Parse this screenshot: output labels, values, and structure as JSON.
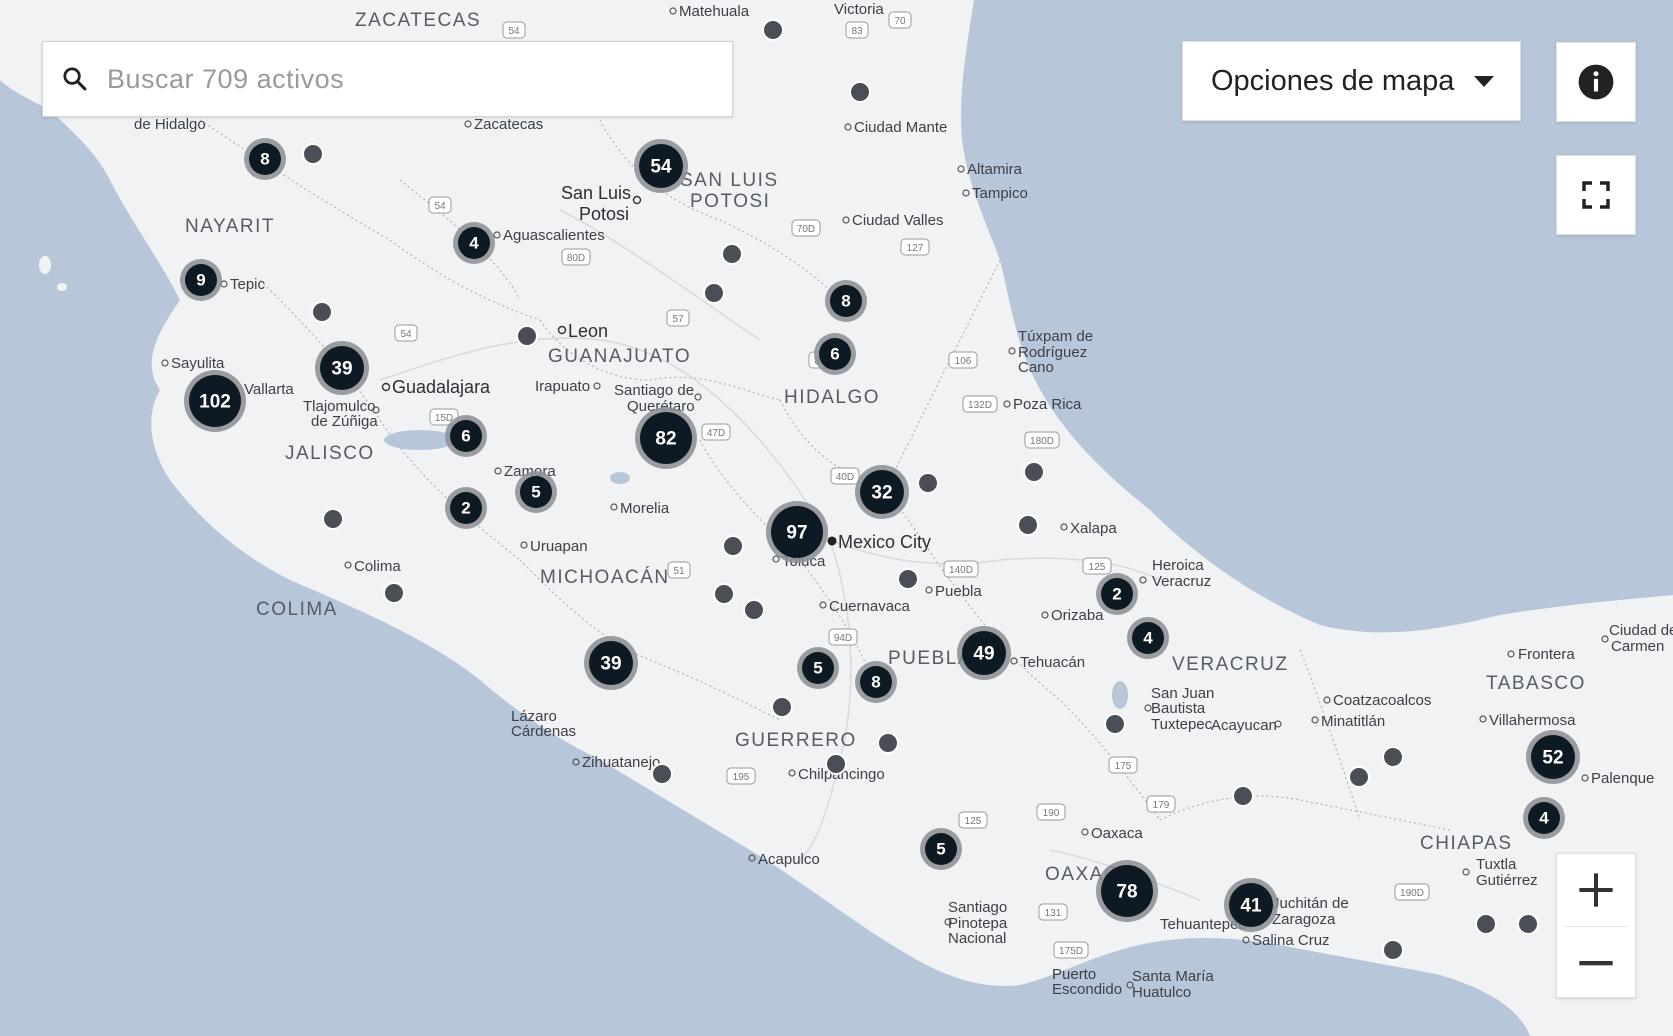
{
  "search": {
    "placeholder": "Buscar 709 activos"
  },
  "map_options": {
    "label": "Opciones de mapa"
  },
  "controls": {
    "info_icon": "info-icon",
    "fullscreen_icon": "fullscreen-icon",
    "zoom_in_icon": "plus-icon",
    "zoom_out_icon": "minus-icon"
  },
  "colors": {
    "water": "#b8c6da",
    "land": "#f1f2f3",
    "cluster": "#0e1a23",
    "marker": "#4a4f57"
  },
  "states": [
    {
      "name": "ZACATECAS"
    },
    {
      "name": "NAYARIT"
    },
    {
      "name": "SAN LUIS"
    },
    {
      "name": "POTOSI"
    },
    {
      "name": "GUANAJUATO"
    },
    {
      "name": "HIDALGO"
    },
    {
      "name": "JALISCO"
    },
    {
      "name": "MICHOACÁN"
    },
    {
      "name": "COLIMA"
    },
    {
      "name": "PUEBLA"
    },
    {
      "name": "VERACRUZ"
    },
    {
      "name": "GUERRERO"
    },
    {
      "name": "OAXACA"
    },
    {
      "name": "TABASCO"
    },
    {
      "name": "CHIAPAS"
    }
  ],
  "cities": [
    {
      "name": "Matehuala"
    },
    {
      "name": "Victoria"
    },
    {
      "name": "de Hidalgo"
    },
    {
      "name": "Zacatecas"
    },
    {
      "name": "Ciudad Mante"
    },
    {
      "name": "San Luis"
    },
    {
      "name": "Potosi"
    },
    {
      "name": "Altamira"
    },
    {
      "name": "Tampico"
    },
    {
      "name": "Aguascalientes"
    },
    {
      "name": "Ciudad Valles"
    },
    {
      "name": "Tepic"
    },
    {
      "name": "Leon"
    },
    {
      "name": "Túxpam de"
    },
    {
      "name": "Rodríguez"
    },
    {
      "name": "Cano"
    },
    {
      "name": "Sayulita"
    },
    {
      "name": "Vallarta"
    },
    {
      "name": "Guadalajara"
    },
    {
      "name": "Irapuato"
    },
    {
      "name": "Santiago de"
    },
    {
      "name": "Querétaro"
    },
    {
      "name": "Poza Rica"
    },
    {
      "name": "Tlajomulco"
    },
    {
      "name": "de Zúñiga"
    },
    {
      "name": "Zamora"
    },
    {
      "name": "Morelia"
    },
    {
      "name": "Mexico City"
    },
    {
      "name": "Xalapa"
    },
    {
      "name": "Uruapan"
    },
    {
      "name": "Toluca"
    },
    {
      "name": "Colima"
    },
    {
      "name": "Heroica"
    },
    {
      "name": "Veracruz"
    },
    {
      "name": "Puebla"
    },
    {
      "name": "Cuernavaca"
    },
    {
      "name": "Orizaba"
    },
    {
      "name": "Tehuacán"
    },
    {
      "name": "Frontera"
    },
    {
      "name": "Ciudad del"
    },
    {
      "name": "Carmen"
    },
    {
      "name": "San Juan"
    },
    {
      "name": "Bautista"
    },
    {
      "name": "Tuxtepec"
    },
    {
      "name": "Acayucan"
    },
    {
      "name": "Coatzacoalcos"
    },
    {
      "name": "Minatitlán"
    },
    {
      "name": "Villahermosa"
    },
    {
      "name": "Lázaro"
    },
    {
      "name": "Cárdenas"
    },
    {
      "name": "Zihuatanejo"
    },
    {
      "name": "Chilpancingo"
    },
    {
      "name": "Palenque"
    },
    {
      "name": "Oaxaca"
    },
    {
      "name": "Acapulco"
    },
    {
      "name": "Tuxtla"
    },
    {
      "name": "Gutiérrez"
    },
    {
      "name": "Santiago"
    },
    {
      "name": "Pinotepa"
    },
    {
      "name": "Nacional"
    },
    {
      "name": "Juchitán de"
    },
    {
      "name": "Zaragoza"
    },
    {
      "name": "Tehuantepec"
    },
    {
      "name": "Salina Cruz"
    },
    {
      "name": "Puerto"
    },
    {
      "name": "Escondido"
    },
    {
      "name": "Santa María"
    },
    {
      "name": "Huatulco"
    },
    {
      "name": "Ciudad Mante"
    }
  ],
  "highways": [
    "54",
    "83",
    "70",
    "54",
    "70D",
    "127",
    "80D",
    "57",
    "54",
    "106",
    "85",
    "132D",
    "15D",
    "180D",
    "47D",
    "40D",
    "51",
    "140D",
    "125",
    "94D",
    "195",
    "125",
    "190",
    "175",
    "179",
    "131",
    "175D",
    "190D"
  ],
  "clusters": [
    {
      "count": "8"
    },
    {
      "count": "54"
    },
    {
      "count": "4"
    },
    {
      "count": "9"
    },
    {
      "count": "8"
    },
    {
      "count": "6"
    },
    {
      "count": "39"
    },
    {
      "count": "102"
    },
    {
      "count": "82"
    },
    {
      "count": "6"
    },
    {
      "count": "5"
    },
    {
      "count": "2"
    },
    {
      "count": "32"
    },
    {
      "count": "97"
    },
    {
      "count": "2"
    },
    {
      "count": "4"
    },
    {
      "count": "49"
    },
    {
      "count": "39"
    },
    {
      "count": "5"
    },
    {
      "count": "8"
    },
    {
      "count": "52"
    },
    {
      "count": "4"
    },
    {
      "count": "5"
    },
    {
      "count": "78"
    },
    {
      "count": "41"
    }
  ]
}
